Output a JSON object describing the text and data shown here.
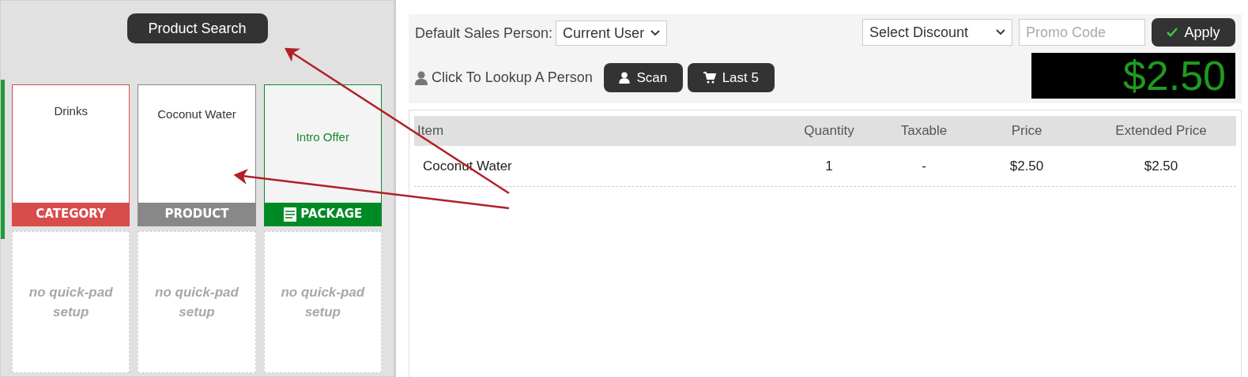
{
  "product_search": "Product Search",
  "tiles": [
    {
      "kind": "category",
      "name": "Drinks",
      "label": "CATEGORY"
    },
    {
      "kind": "product",
      "name": "Coconut Water",
      "label": "PRODUCT"
    },
    {
      "kind": "package",
      "name": "Intro Offer",
      "label": "PACKAGE"
    },
    {
      "kind": "empty",
      "name": "no quick-pad setup"
    },
    {
      "kind": "empty",
      "name": "no quick-pad setup"
    },
    {
      "kind": "empty",
      "name": "no quick-pad setup"
    }
  ],
  "sales_person": {
    "label": "Default Sales Person:",
    "value": "Current User"
  },
  "discount": {
    "value": "Select Discount"
  },
  "promo": {
    "placeholder": "Promo Code"
  },
  "apply": "Apply",
  "lookup": "Click To Lookup A Person",
  "scan": "Scan",
  "last5": "Last 5",
  "total": "$2.50",
  "table": {
    "columns": [
      "Item",
      "Quantity",
      "Taxable",
      "Price",
      "Extended Price"
    ],
    "rows": [
      [
        "Coconut Water",
        "1",
        "-",
        "$2.50",
        "$2.50"
      ]
    ]
  }
}
